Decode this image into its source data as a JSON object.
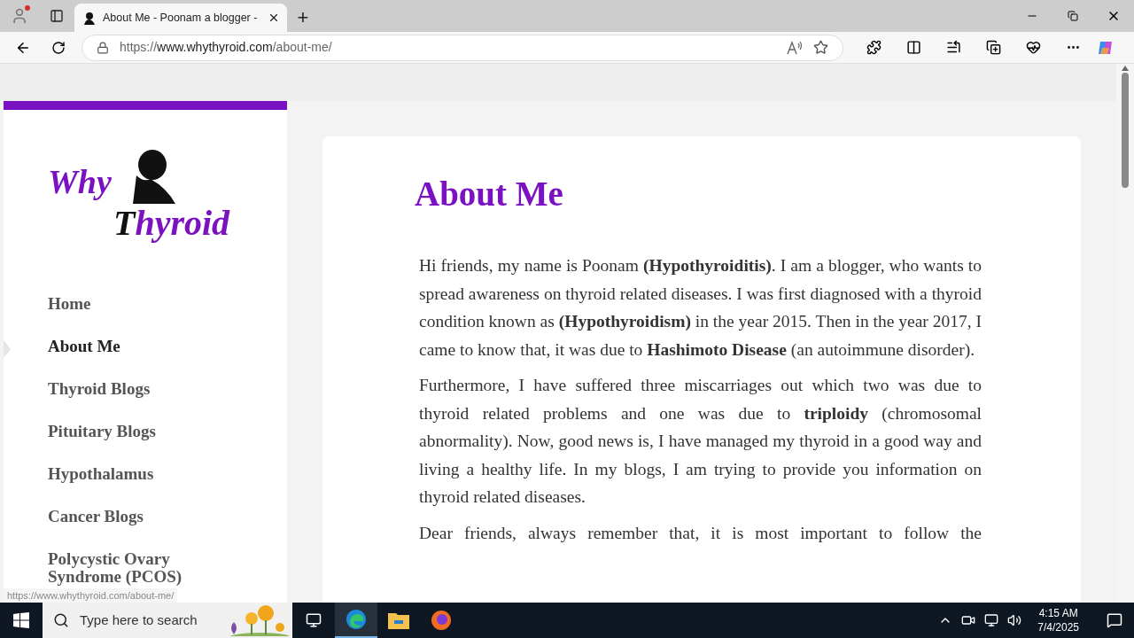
{
  "browser": {
    "tab": {
      "title": "About Me - Poonam a blogger -",
      "selected": true
    },
    "new_tab": "+",
    "url": {
      "scheme": "https://",
      "host": "www.whythyroid.com",
      "path": "/about-me/"
    }
  },
  "logo": {
    "line1": "Why",
    "line2_first": "T",
    "line2_rest": "hyroid"
  },
  "nav": [
    {
      "label": "Home",
      "selected": false
    },
    {
      "label": "About Me",
      "selected": true
    },
    {
      "label": "Thyroid Blogs",
      "selected": false
    },
    {
      "label": "Pituitary Blogs",
      "selected": false
    },
    {
      "label": "Hypothalamus",
      "selected": false
    },
    {
      "label": "Cancer Blogs",
      "selected": false
    },
    {
      "label": "Polycystic Ovary Syndrome (PCOS)",
      "selected": false
    }
  ],
  "status_url": "https://www.whythyroid.com/about-me/",
  "article": {
    "title": "About Me",
    "paragraphs": [
      {
        "text": "Hi friends, my name is Poonam **(Hypothyroiditis)**. I am a blogger, who wants to spread awareness on thyroid related diseases. I was first diagnosed with a thyroid condition known as **(Hypothyroidism)** in the year 2015. Then in the year 2017, I came to know that, it was due to **Hashimoto Disease** (an autoimmune disorder).",
        "cut": false
      },
      {
        "text": "Furthermore, I have suffered three miscarriages out which two was due to thyroid related problems and one was due to **triploidy** (chromosomal abnormality). Now, good news is, I have managed my thyroid in a good way and living a healthy life. In my blogs, I am trying to provide you information on thyroid related diseases.",
        "cut": false
      },
      {
        "text": "Dear friends, always remember that, it is most important to follow the",
        "cut": true
      }
    ]
  },
  "taskbar": {
    "search_placeholder": "Type here to search",
    "time": "4:15 AM",
    "date": "7/4/2025"
  }
}
